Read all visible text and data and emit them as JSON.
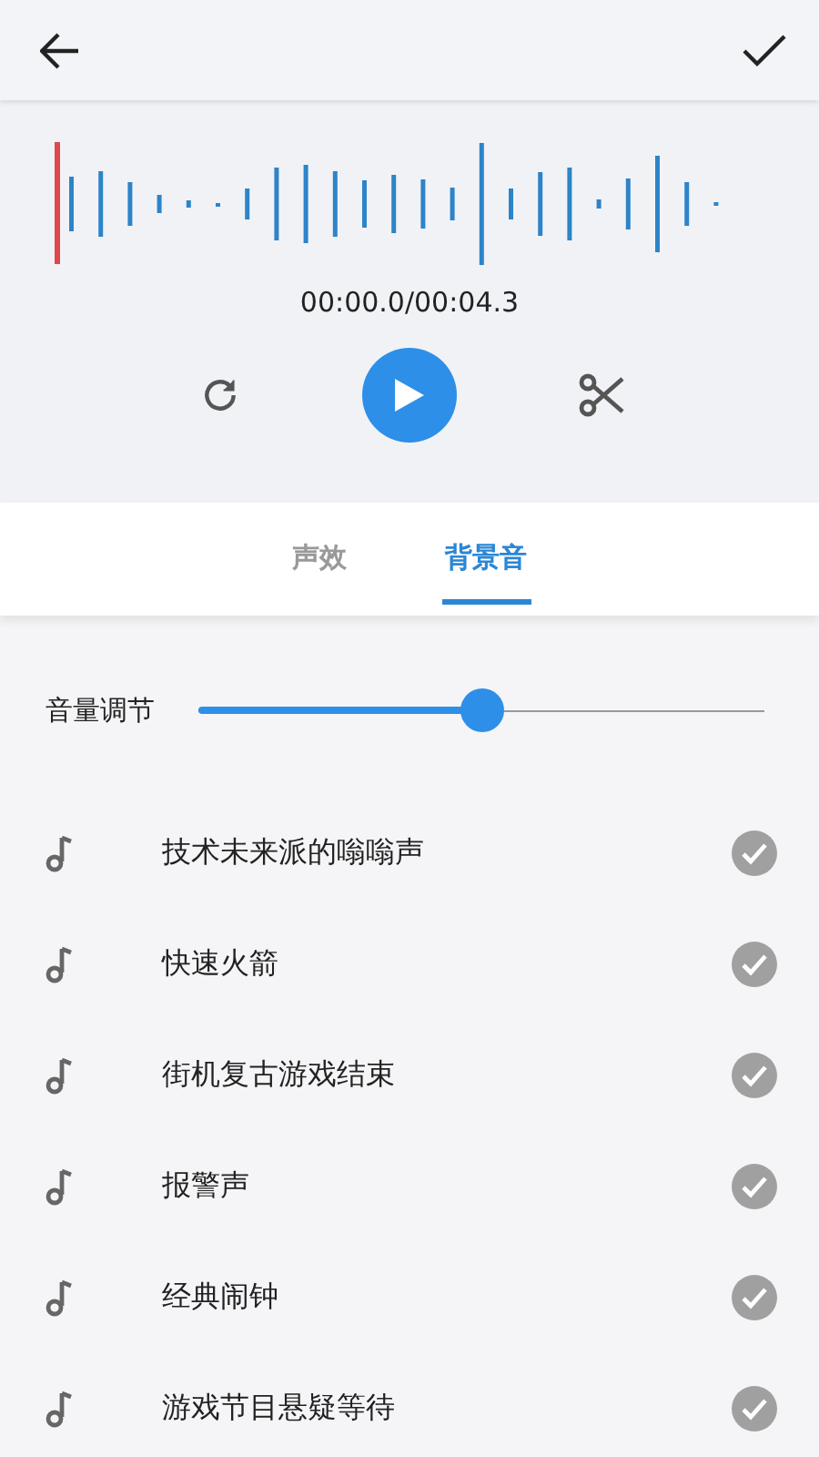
{
  "player": {
    "time": "00:00.0/00:04.3"
  },
  "tabs": [
    {
      "label": "声效",
      "selected": false
    },
    {
      "label": "背景音",
      "selected": true
    }
  ],
  "volume": {
    "label": "音量调节",
    "level": 0.5
  },
  "sounds": [
    {
      "name": "技术未来派的嗡嗡声"
    },
    {
      "name": "快速火箭"
    },
    {
      "name": "街机复古游戏结束"
    },
    {
      "name": "报警声"
    },
    {
      "name": "经典闹钟"
    },
    {
      "name": "游戏节目悬疑等待"
    }
  ]
}
